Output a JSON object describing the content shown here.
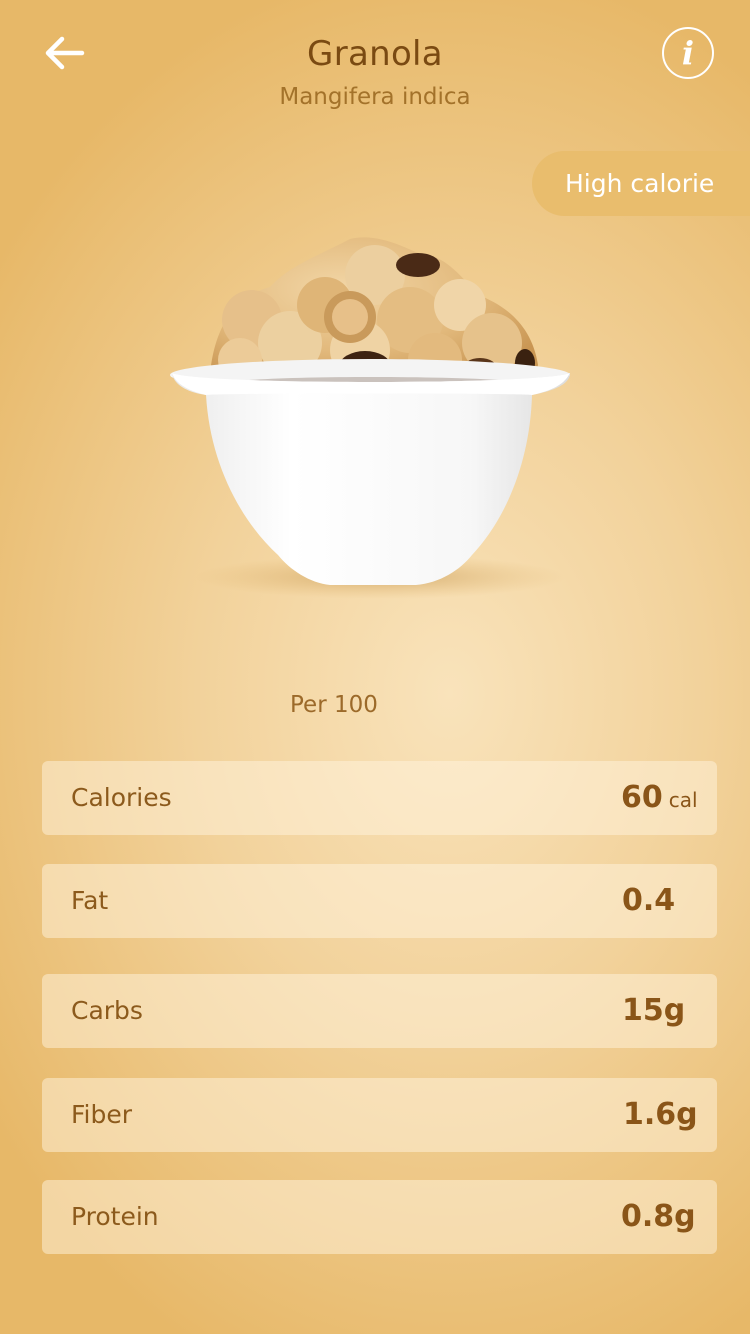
{
  "header": {
    "title": "Granola",
    "subtitle": "Mangifera indica",
    "back_icon": "back-arrow-icon",
    "info_icon": "info-icon",
    "info_glyph": "i"
  },
  "badge": {
    "label": "High calorie"
  },
  "food_image": {
    "description": "granola-bowl-image"
  },
  "serving": {
    "label": "Per 100"
  },
  "nutrients": [
    {
      "label": "Calories",
      "value": "60",
      "unit": "cal"
    },
    {
      "label": "Fat",
      "value": "0.4",
      "unit": ""
    },
    {
      "label": "Carbs",
      "value": "15g",
      "unit": ""
    },
    {
      "label": "Fiber",
      "value": "1.6g",
      "unit": ""
    },
    {
      "label": "Protein",
      "value": "0.8g",
      "unit": ""
    }
  ],
  "colors": {
    "background": "#f2d29b",
    "badge": "#e9bd6d",
    "title": "#7a4a12",
    "accent_text": "#8a5518"
  }
}
